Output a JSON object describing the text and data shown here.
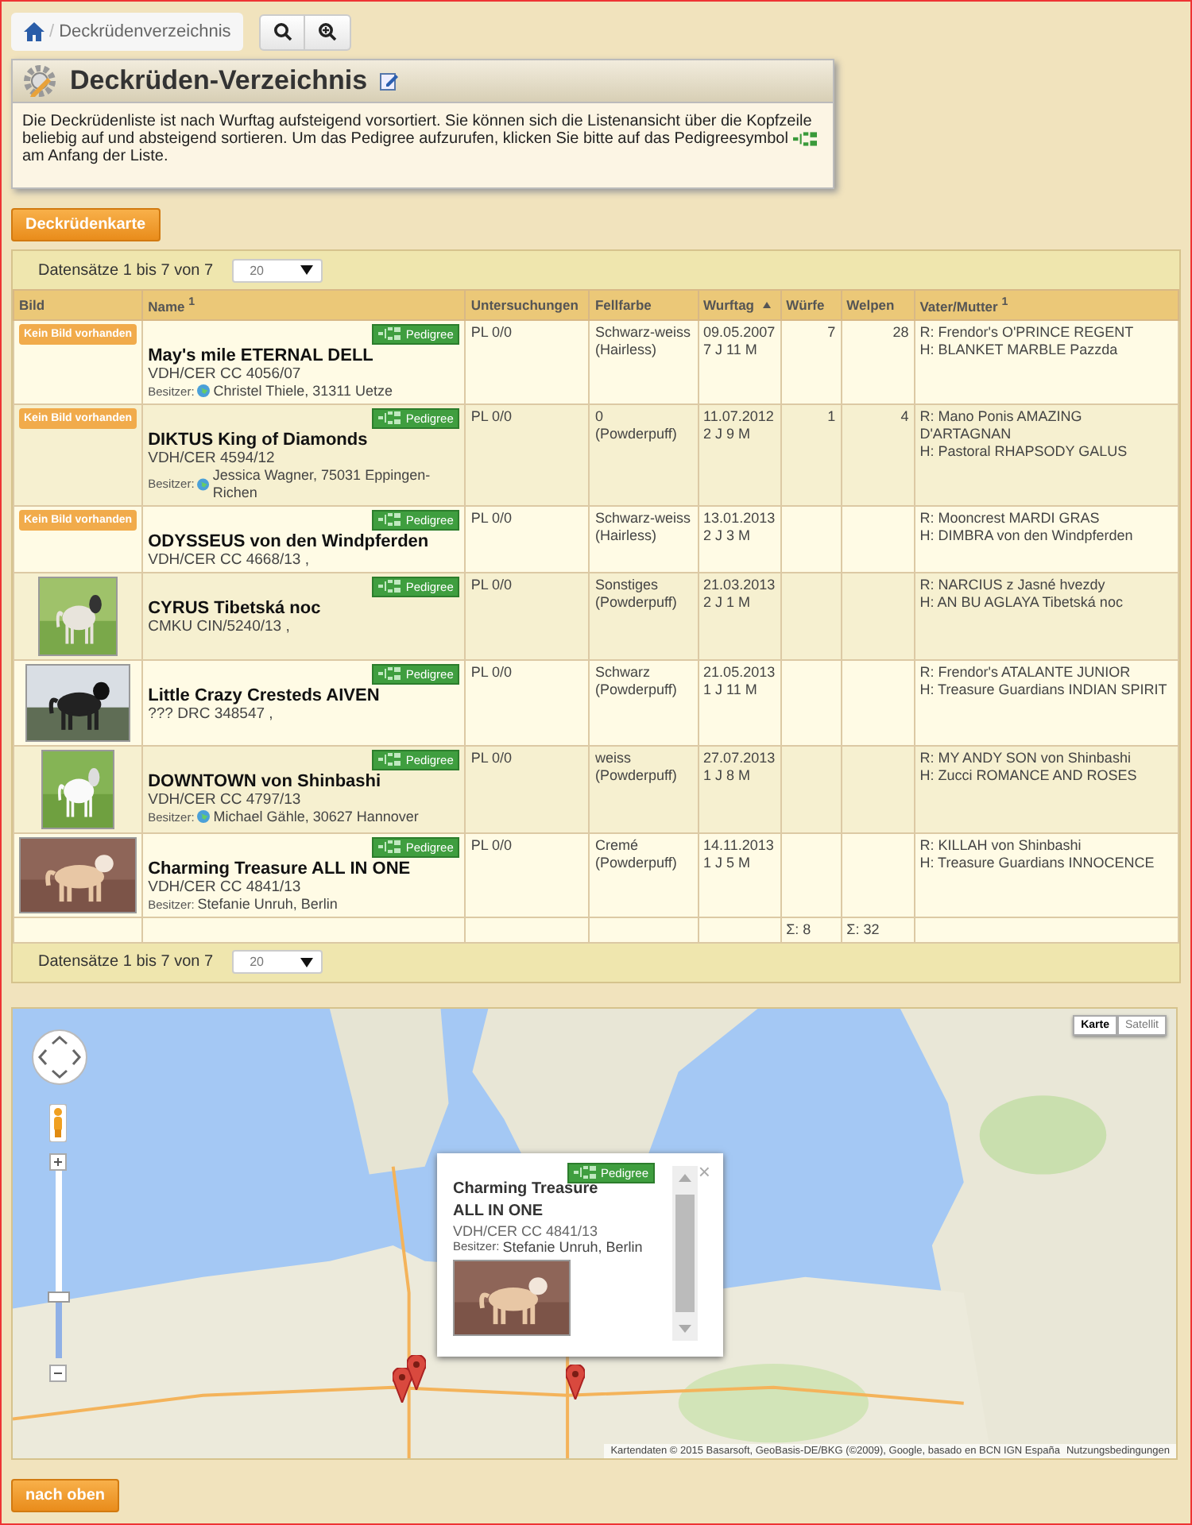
{
  "breadcrumb": {
    "separator": "/",
    "label": "Deckrüdenverzeichnis"
  },
  "panel": {
    "title": "Deckrüden-Verzeichnis",
    "text_before": "Die Deckrüdenliste ist nach Wurftag aufsteigend vorsortiert. Sie können sich die Listenansicht über die Kopfzeile beliebig auf und absteigend sortieren. Um das Pedigree aufzurufen, klicken Sie bitte auf das Pedigreesymbol",
    "text_after": "am Anfang der Liste."
  },
  "map_button": "Deckrüdenkarte",
  "pager_top": {
    "label": "Datensätze 1 bis 7 von 7",
    "page_size": "20"
  },
  "columns": [
    {
      "label": "Bild",
      "sorted": false
    },
    {
      "label": "Name $^{1}$",
      "sorted": false
    },
    {
      "label": "Untersuchungen",
      "sorted": false
    },
    {
      "label": "Fellfarbe",
      "sorted": false
    },
    {
      "label": "Wurftag",
      "sorted": true
    },
    {
      "label": "Würfe",
      "sorted": false
    },
    {
      "label": "Welpen",
      "sorted": false
    },
    {
      "label": "Vater/Mutter $^{1}$",
      "sorted": false
    }
  ],
  "rows": [
    {
      "image": {
        "kind": "none",
        "label": "Kein Bild vorhanden"
      },
      "pedigree": "Pedigree",
      "name": "May's mile ETERNAL DELL",
      "reg": "VDH/CER CC 4056/07",
      "owner_label": "Besitzer:",
      "owner": "Christel Thiele, 31311 Uetze",
      "globe": true,
      "exam": "PL 0/0",
      "coat": "Schwarz-weiss",
      "coat_type": "(Hairless)",
      "date": "09.05.2007",
      "age": "7 J 11 M",
      "litters": "7",
      "puppies": "28",
      "sire": "R: Frendor's O'PRINCE REGENT",
      "dam": "H: BLANKET MARBLE Pazzda"
    },
    {
      "image": {
        "kind": "none",
        "label": "Kein Bild vorhanden"
      },
      "pedigree": "Pedigree",
      "name": "DIKTUS King of Diamonds",
      "reg": "VDH/CER 4594/12",
      "owner_label": "Besitzer:",
      "owner": "Jessica Wagner, 75031 Eppingen-Richen",
      "globe": true,
      "exam": "PL 0/0",
      "coat": "0",
      "coat_type": "(Powderpuff)",
      "date": "11.07.2012",
      "age": "2 J 9 M",
      "litters": "1",
      "puppies": "4",
      "sire": "R: Mano Ponis AMAZING D'ARTAGNAN",
      "dam": "H: Pastoral RHAPSODY GALUS"
    },
    {
      "image": {
        "kind": "none",
        "label": "Kein Bild vorhanden"
      },
      "pedigree": "Pedigree",
      "name": "ODYSSEUS von den Windpferden",
      "reg": "VDH/CER CC 4668/13 ,",
      "exam": "PL 0/0",
      "coat": "Schwarz-weiss",
      "coat_type": "(Hairless)",
      "date": "13.01.2013",
      "age": "2 J 3 M",
      "sire": "R: Mooncrest MARDI GRAS",
      "dam": "H: DIMBRA von den Windpferden"
    },
    {
      "pedigree": "Pedigree",
      "name": "CYRUS Tibetská noc",
      "reg": "CMKU CIN/5240/13 ,",
      "exam": "PL 0/0",
      "coat": "Sonstiges",
      "coat_type": "(Powderpuff)",
      "date": "21.03.2013",
      "age": "2 J 1 M",
      "sire": "R: NARCIUS z Jasné hvezdy",
      "dam": "H: AN BU AGLAYA Tibetská noc"
    },
    {
      "pedigree": "Pedigree",
      "name": "Little Crazy Cresteds AIVEN",
      "reg": "??? DRC 348547 ,",
      "exam": "PL 0/0",
      "coat": "Schwarz",
      "coat_type": "(Powderpuff)",
      "date": "21.05.2013",
      "age": "1 J 11 M",
      "sire": "R: Frendor's ATALANTE JUNIOR",
      "dam": "H: Treasure Guardians INDIAN SPIRIT"
    },
    {
      "pedigree": "Pedigree",
      "name": "DOWNTOWN von Shinbashi",
      "reg": "VDH/CER CC 4797/13",
      "owner_label": "Besitzer:",
      "owner": "Michael Gähle, 30627 Hannover",
      "globe": true,
      "exam": "PL 0/0",
      "coat": "weiss",
      "coat_type": "(Powderpuff)",
      "date": "27.07.2013",
      "age": "1 J 8 M",
      "sire": "R: MY ANDY SON von Shinbashi",
      "dam": "H: Zucci ROMANCE AND ROSES"
    },
    {
      "pedigree": "Pedigree",
      "name": "Charming Treasure ALL IN ONE",
      "reg": "VDH/CER CC 4841/13",
      "owner_label": "Besitzer:",
      "owner": "Stefanie Unruh, Berlin",
      "globe": false,
      "exam": "PL 0/0",
      "coat": "Cremé",
      "coat_type": "(Powderpuff)",
      "date": "14.11.2013",
      "age": "1 J 5 M",
      "sire": "R: KILLAH von Shinbashi",
      "dam": "H: Treasure Guardians INNOCENCE"
    }
  ],
  "totals": {
    "litters": "Σ: 8",
    "puppies": "Σ: 32"
  },
  "pager_bottom": {
    "label": "Datensätze 1 bis 7 von 7",
    "page_size": "20"
  },
  "map": {
    "types": [
      {
        "label": "Karte",
        "selected": true
      },
      {
        "label": "Satellit",
        "selected": false
      }
    ],
    "zoom": {
      "level": 0.31
    },
    "popup": {
      "pedigree": "Pedigree",
      "close": "×",
      "name": "Charming Treasure ALL IN ONE",
      "reg": "VDH/CER CC 4841/13",
      "owner_label": "Besitzer:",
      "owner": "Stefanie Unruh, Berlin"
    },
    "attribution": "Kartendaten © 2015 Basarsoft, GeoBasis-DE/BKG (©2009), Google, basado en BCN IGN España",
    "terms": "Nutzungsbedingungen"
  },
  "top_button": "nach oben"
}
